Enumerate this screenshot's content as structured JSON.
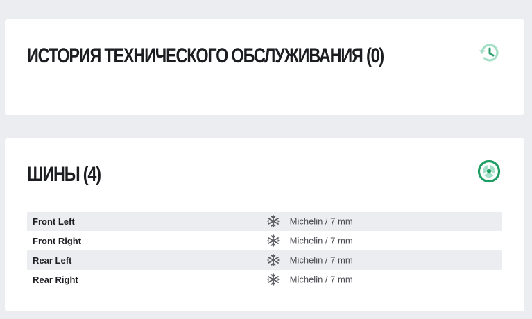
{
  "history": {
    "title": "ИСТОРИЯ ТЕХНИЧЕСКОГО ОБСЛУЖИВАНИЯ (0)",
    "icon": "history-icon",
    "icon_color": "#a6e0c8"
  },
  "tires": {
    "title": "ШИНЫ (4)",
    "icon": "wheel-icon",
    "icon_color": "#1f9e64",
    "rows": [
      {
        "position": "Front Left",
        "season_icon": "winter-tire-icon",
        "spec": "Michelin / 7 mm"
      },
      {
        "position": "Front Right",
        "season_icon": "winter-tire-icon",
        "spec": "Michelin / 7 mm"
      },
      {
        "position": "Rear Left",
        "season_icon": "winter-tire-icon",
        "spec": "Michelin / 7 mm"
      },
      {
        "position": "Rear Right",
        "season_icon": "winter-tire-icon",
        "spec": "Michelin / 7 mm"
      }
    ]
  },
  "colors": {
    "background": "#ecedf1",
    "card": "#ffffff",
    "stripe": "#ecedf1"
  }
}
